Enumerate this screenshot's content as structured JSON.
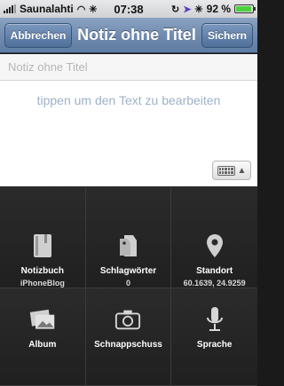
{
  "status_bar": {
    "carrier": "Saunalahti",
    "time": "07:38",
    "battery_percent": "92 %",
    "battery_level": 0.92
  },
  "nav": {
    "cancel_label": "Abbrechen",
    "title": "Notiz ohne Titel",
    "save_label": "Sichern"
  },
  "editor": {
    "title_placeholder": "Notiz ohne Titel",
    "body_placeholder": "tippen um den Text zu bearbeiten"
  },
  "actions": [
    {
      "label": "Notizbuch",
      "sub": "iPhoneBlog",
      "icon": "notebook-icon"
    },
    {
      "label": "Schlagwörter",
      "sub": "0",
      "icon": "tag-icon"
    },
    {
      "label": "Standort",
      "sub": "60.1639, 24.9259",
      "icon": "location-pin-icon"
    },
    {
      "label": "Album",
      "sub": "",
      "icon": "photo-album-icon"
    },
    {
      "label": "Schnappschuss",
      "sub": "",
      "icon": "camera-icon"
    },
    {
      "label": "Sprache",
      "sub": "",
      "icon": "microphone-icon"
    }
  ],
  "colors": {
    "nav_blue": "#6f8aae",
    "grid_bg": "#242424",
    "placeholder": "#9fb1c7"
  }
}
